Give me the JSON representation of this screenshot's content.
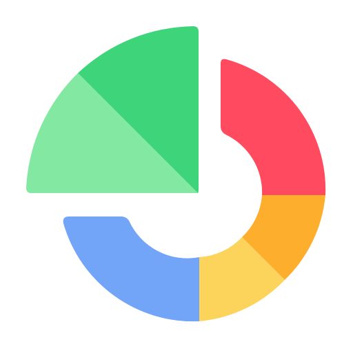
{
  "icon": {
    "name": "pie-chart-icon",
    "colors": {
      "background": "#FFFFFF",
      "wedge_dark_green": "#3ED47A",
      "wedge_light_green": "#82E8A2",
      "ring_red": "#FF4A5F",
      "ring_orange": "#FCAE2C",
      "ring_yellow": "#FCD35B",
      "ring_blue": "#72A4F8"
    }
  }
}
